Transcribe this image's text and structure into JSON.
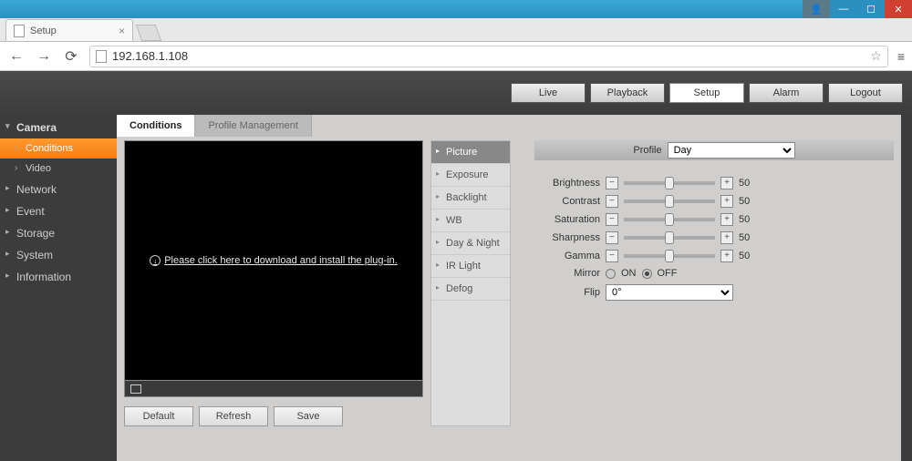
{
  "window": {
    "tab_title": "Setup",
    "url": "192.168.1.108"
  },
  "topnav": {
    "live": "Live",
    "playback": "Playback",
    "setup": "Setup",
    "alarm": "Alarm",
    "logout": "Logout",
    "active": "Setup"
  },
  "sidebar": {
    "camera": "Camera",
    "conditions": "Conditions",
    "video": "Video",
    "network": "Network",
    "event": "Event",
    "storage": "Storage",
    "system": "System",
    "information": "Information"
  },
  "subtabs": {
    "conditions": "Conditions",
    "profile_mgmt": "Profile Management"
  },
  "video": {
    "plugin_msg": "Please click here to download and install the plug-in."
  },
  "buttons": {
    "default": "Default",
    "refresh": "Refresh",
    "save": "Save"
  },
  "setmenu": {
    "picture": "Picture",
    "exposure": "Exposure",
    "backlight": "Backlight",
    "wb": "WB",
    "daynight": "Day & Night",
    "irlight": "IR Light",
    "defog": "Defog"
  },
  "profile": {
    "label": "Profile",
    "value": "Day"
  },
  "sliders": {
    "brightness": {
      "label": "Brightness",
      "value": 50
    },
    "contrast": {
      "label": "Contrast",
      "value": 50
    },
    "saturation": {
      "label": "Saturation",
      "value": 50
    },
    "sharpness": {
      "label": "Sharpness",
      "value": 50
    },
    "gamma": {
      "label": "Gamma",
      "value": 50
    }
  },
  "mirror": {
    "label": "Mirror",
    "on": "ON",
    "off": "OFF",
    "value": "OFF"
  },
  "flip": {
    "label": "Flip",
    "value": "0°"
  }
}
